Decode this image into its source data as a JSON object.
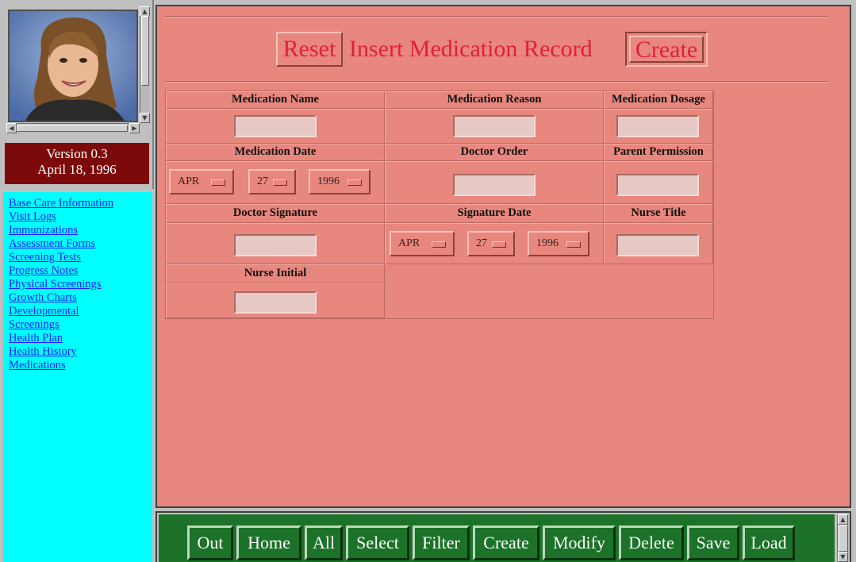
{
  "version": {
    "line1": "Version 0.3",
    "line2": "April 18, 1996"
  },
  "nav": {
    "links": [
      "Base Care Information",
      "Visit Logs",
      "Immunizations",
      "Assessment Forms",
      "Screening Tests",
      "Progress Notes",
      "Physical Screenings",
      "Growth Charts",
      "Developmental",
      "Screenings",
      "Health Plan",
      "Health History",
      "Medications"
    ]
  },
  "form": {
    "reset_label": "Reset",
    "title": "Insert Medication Record",
    "create_label": "Create",
    "labels": {
      "medication_name": "Medication Name",
      "medication_reason": "Medication Reason",
      "medication_dosage": "Medication Dosage",
      "medication_date": "Medication Date",
      "doctor_order": "Doctor Order",
      "parent_permission": "Parent Permission",
      "doctor_signature": "Doctor Signature",
      "signature_date": "Signature Date",
      "nurse_title": "Nurse Title",
      "nurse_initial": "Nurse Initial"
    },
    "medication_date": {
      "month": "APR",
      "day": "27",
      "year": "1996"
    },
    "signature_date": {
      "month": "APR",
      "day": "27",
      "year": "1996"
    },
    "values": {
      "medication_name": "",
      "medication_reason": "",
      "medication_dosage": "",
      "doctor_order": "",
      "parent_permission": "",
      "doctor_signature": "",
      "nurse_title": "",
      "nurse_initial": ""
    }
  },
  "toolbar": {
    "out": "Out",
    "home": "Home",
    "all": "All",
    "select": "Select",
    "filter": "Filter",
    "create": "Create",
    "modify": "Modify",
    "delete": "Delete",
    "save": "Save",
    "load": "Load"
  },
  "colors": {
    "form_bg": "#e8877e",
    "title_red": "#e0203a",
    "version_bg": "#7c0a0a",
    "nav_bg": "#00ffff",
    "link": "#2020ff",
    "toolbar_bg": "#1c7228"
  }
}
